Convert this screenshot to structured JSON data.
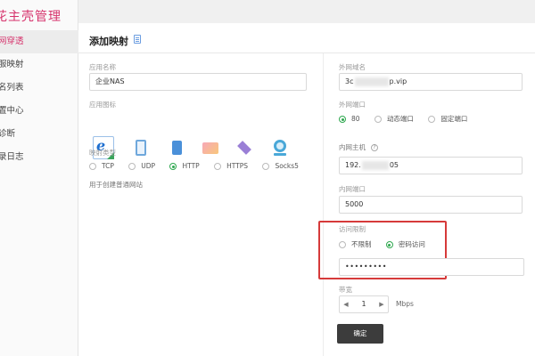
{
  "sidebar": {
    "brand": "花主壳管理",
    "items": [
      {
        "label": "网穿透",
        "active": true
      },
      {
        "label": "服映射",
        "active": false
      },
      {
        "label": "名列表",
        "active": false
      },
      {
        "label": "置中心",
        "active": false
      },
      {
        "label": "诊断",
        "active": false
      },
      {
        "label": "录日志",
        "active": false
      }
    ]
  },
  "card": {
    "title": "添加映射"
  },
  "left": {
    "app_name_label": "应用名称",
    "app_name_value": "企业NAS",
    "app_icon_label": "应用图标",
    "icons": [
      "ie-icon",
      "tablet-icon",
      "phone-icon",
      "film-icon",
      "layers-icon",
      "camera-icon"
    ],
    "type_label": "映射类型",
    "types": [
      {
        "label": "TCP",
        "selected": false
      },
      {
        "label": "UDP",
        "selected": false
      },
      {
        "label": "HTTP",
        "selected": true
      },
      {
        "label": "HTTPS",
        "selected": false
      },
      {
        "label": "Socks5",
        "selected": false
      }
    ],
    "hint": "用于创建普通网站"
  },
  "right": {
    "domain_label": "外网域名",
    "domain_prefix": "3c",
    "domain_suffix": "p.vip",
    "port_label": "外网端口",
    "ports": [
      {
        "label": "80",
        "selected": true
      },
      {
        "label": "动态端口",
        "selected": false
      },
      {
        "label": "固定端口",
        "selected": false
      }
    ],
    "host_label": "内网主机",
    "host_prefix": "192.",
    "host_suffix": "05",
    "inner_port_label": "内网端口",
    "inner_port_value": "5000",
    "access_label": "访问限制",
    "access_options": [
      {
        "label": "不限制",
        "selected": false
      },
      {
        "label": "密码访问",
        "selected": true
      }
    ],
    "password_value": "•••••••••",
    "bandwidth_label": "带宽",
    "bandwidth_value": "1",
    "bandwidth_unit": "Mbps",
    "confirm_label": "确定"
  },
  "colors": {
    "accent": "#d6336c",
    "radio_on": "#2fa84f",
    "highlight": "#d63a3a",
    "button": "#3c3c3c"
  }
}
